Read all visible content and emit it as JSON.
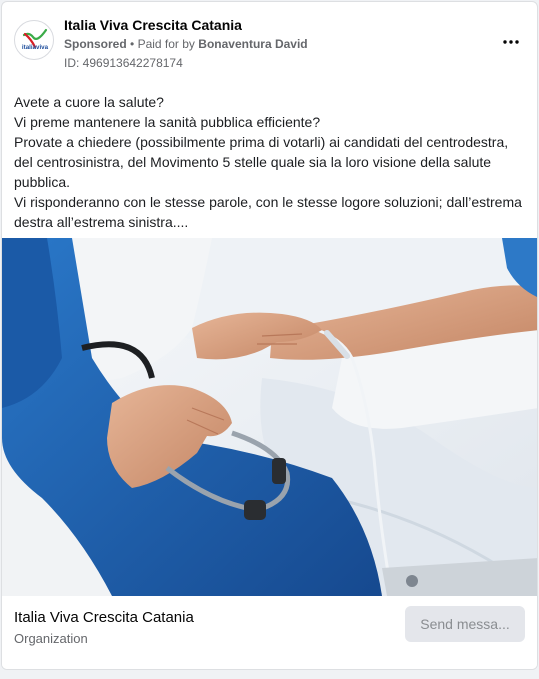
{
  "ad": {
    "page_name": "Italia Viva Crescita Catania",
    "sponsored_label": "Sponsored",
    "separator": "•",
    "paid_for_prefix": "Paid for by",
    "payer": "Bonaventura David",
    "id_line": "ID: 496913642278174",
    "avatar_logo_text": "italiaviva",
    "more_icon": "more-horizontal-icon"
  },
  "post": {
    "lines": [
      "Avete a cuore la salute?",
      "Vi preme mantenere la sanità pubblica efficiente?",
      "Provate a chiedere (possibilmente prima di votarli) ai candidati del centrodestra, del centrosinistra, del Movimento 5 stelle quale sia la loro visione della salute pubblica.",
      "Vi risponderanno con le stesse parole, con le stesse logore soluzioni; dall’estrema destra all’estrema sinistra...."
    ]
  },
  "footer": {
    "title": "Italia Viva Crescita Catania",
    "subtitle": "Organization",
    "cta_label": "Send messa..."
  },
  "colors": {
    "brand_red": "#d71f26",
    "brand_green": "#3bab48",
    "brand_blue": "#1f4e9c",
    "scrubs_blue": "#1f5fb0",
    "cta_bg": "#e4e6eb"
  }
}
